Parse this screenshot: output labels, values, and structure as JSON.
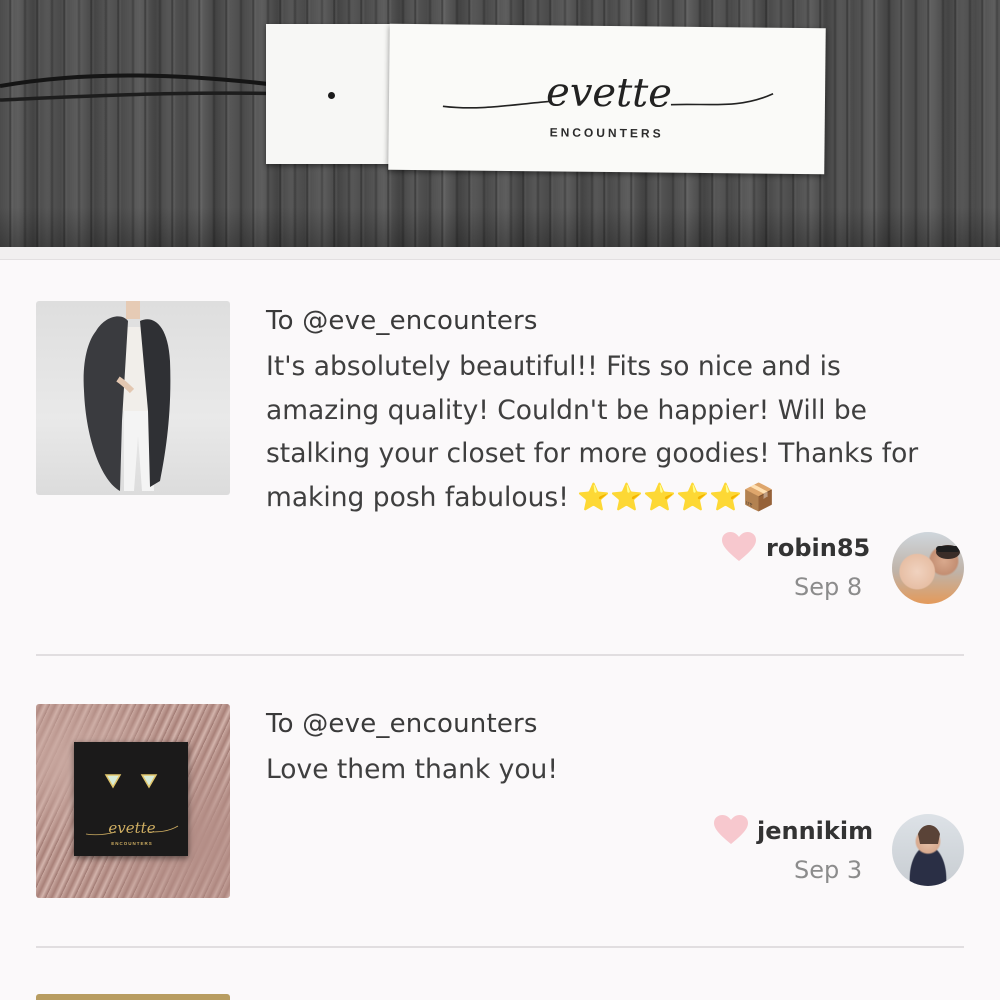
{
  "banner": {
    "brand_script": "evette",
    "brand_sub": "ENCOUNTERS"
  },
  "reviews": [
    {
      "to": "To @eve_encounters",
      "text": "It's absolutely beautiful!! Fits so nice and is amazing quality! Couldn't be happier! Will be stalking your closet for more goodies! Thanks for making posh fabulous! ⭐⭐⭐⭐⭐📦",
      "reviewer": "robin85",
      "date": "Sep 8",
      "thumb_icon": "cardigan-photo",
      "avatar_icon": "avatar-photo"
    },
    {
      "to": "To @eve_encounters",
      "text": "Love them thank you!",
      "reviewer": "jennikim",
      "date": "Sep 3",
      "thumb_icon": "earrings-photo",
      "thumb_brand_script": "evette",
      "thumb_brand_sub": "ENCOUNTERS",
      "avatar_icon": "avatar-photo"
    }
  ],
  "colors": {
    "heart": "#f7c8ce",
    "background": "#fbf9fa",
    "separator": "#e1dee0"
  }
}
